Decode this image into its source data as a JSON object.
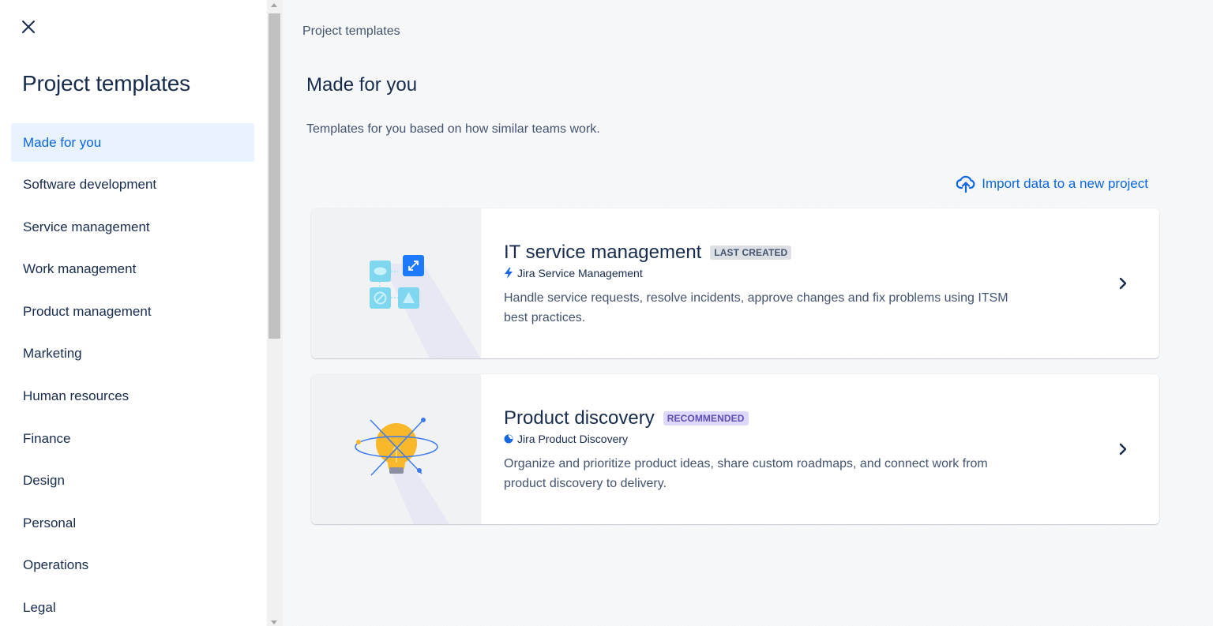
{
  "sidebar": {
    "title": "Project templates",
    "items": [
      {
        "label": "Made for you",
        "active": true
      },
      {
        "label": "Software development"
      },
      {
        "label": "Service management"
      },
      {
        "label": "Work management"
      },
      {
        "label": "Product management"
      },
      {
        "label": "Marketing"
      },
      {
        "label": "Human resources"
      },
      {
        "label": "Finance"
      },
      {
        "label": "Design"
      },
      {
        "label": "Personal"
      },
      {
        "label": "Operations"
      },
      {
        "label": "Legal"
      }
    ]
  },
  "main": {
    "breadcrumb": "Project templates",
    "title": "Made for you",
    "description": "Templates for you based on how similar teams work.",
    "import_label": "Import data to a new project",
    "cards": [
      {
        "title": "IT service management",
        "badge": "LAST CREATED",
        "product": "Jira Service Management",
        "description": "Handle service requests, resolve incidents, approve changes and fix problems using ITSM best practices."
      },
      {
        "title": "Product discovery",
        "badge": "RECOMMENDED",
        "product": "Jira Product Discovery",
        "description": "Organize and prioritize product ideas, share custom roadmaps, and connect work from product discovery to delivery."
      }
    ]
  },
  "colors": {
    "accent": "#0c66e4",
    "active_bg": "#e9f2ff",
    "text": "#172b4d",
    "subtle_text": "#44546f",
    "badge_grey": "#dcdfe4",
    "badge_purple": "#dfd8fd"
  },
  "icons": {
    "close": "close-icon",
    "import": "cloud-upload-icon",
    "chevron": "chevron-right-icon",
    "jsm": "lightning-icon",
    "jpd": "jira-product-discovery-icon"
  }
}
